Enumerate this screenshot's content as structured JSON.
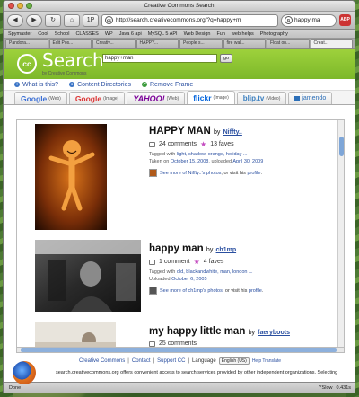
{
  "window": {
    "title": "Creative Commons Search"
  },
  "toolbar": {
    "back": "◀",
    "forward": "▶",
    "reload": "↻",
    "home": "⌂",
    "page_count": "1P",
    "url": "http://search.creativecommons.org/?q=happy+m",
    "search_engine_icon": "G",
    "search_value": "happy ma",
    "adblock_label": "ABP"
  },
  "bookmarks": [
    "Spymaster",
    "Cool",
    "School",
    "CLASSES",
    "WP",
    "Java 6 api",
    "MySQL 5 API",
    "Web Design",
    "Fun",
    "web helps",
    "Photography"
  ],
  "browser_tabs": [
    {
      "label": "Pandora...",
      "active": false
    },
    {
      "label": "Edit Pos...",
      "active": false
    },
    {
      "label": "Creativ...",
      "active": false
    },
    {
      "label": "HAPPY...",
      "active": false
    },
    {
      "label": "People s...",
      "active": false
    },
    {
      "label": "fire wal...",
      "active": false
    },
    {
      "label": "Float on...",
      "active": false
    },
    {
      "label": "Creat...",
      "active": true
    }
  ],
  "cc": {
    "logo_text": "cc",
    "title": "Search",
    "subtitle": "by Creative Commons",
    "query": "happy+man",
    "go": "go",
    "menu": {
      "what": "What is this?",
      "content": "Content Directories",
      "remove": "Remove Frame"
    }
  },
  "engines": [
    {
      "name": "Google",
      "sub": "(Web)"
    },
    {
      "name": "Google",
      "sub": "(Image)"
    },
    {
      "name": "YAHOO!",
      "sub": "(Web)"
    },
    {
      "name": "flickr",
      "sub": "(Image)"
    },
    {
      "name": "blip.tv",
      "sub": "(Video)"
    },
    {
      "name": "jamendo",
      "sub": ""
    }
  ],
  "results": [
    {
      "title": "HAPPY MAN",
      "by": "by",
      "author": "Niffty..",
      "comments": "24 comments",
      "faves": "13 faves",
      "tags_label": "Tagged with",
      "tags": "light, shadow, orange, holiday ...",
      "taken_label": "Taken on",
      "taken": "October 15, 2008",
      "uploaded_label": "uploaded",
      "uploaded": "April 30, 2009",
      "see_more": "See more of Niffty..'s photos",
      "visit_pre": ", or visit his",
      "profile": "profile",
      "period": "."
    },
    {
      "title": "happy man",
      "by": "by",
      "author": "ch1mp",
      "comments": "1 comment",
      "faves": "4 faves",
      "tags_label": "Tagged with",
      "tags": "old, blackandwhite, man, london ...",
      "uploaded_label": "Uploaded",
      "uploaded": "October 6, 2005",
      "see_more": "See more of ch1mp's photos",
      "visit_pre": ", or visit his",
      "profile": "profile",
      "period": "."
    },
    {
      "title": "my happy little man",
      "by": "by",
      "author": "faeryboots",
      "comments": "25 comments"
    }
  ],
  "footer": {
    "links": [
      "Creative Commons",
      "Contact",
      "Support CC"
    ],
    "language_label": "Language",
    "language_value": "English (US)",
    "help_translate": "Help Translate",
    "disclaimer": "search.creativecommons.org offers convenient access to search services provided by other independent organizations. Selecting"
  },
  "status": {
    "left": "Done",
    "yslow": "YSlow",
    "time": "0.431s"
  }
}
